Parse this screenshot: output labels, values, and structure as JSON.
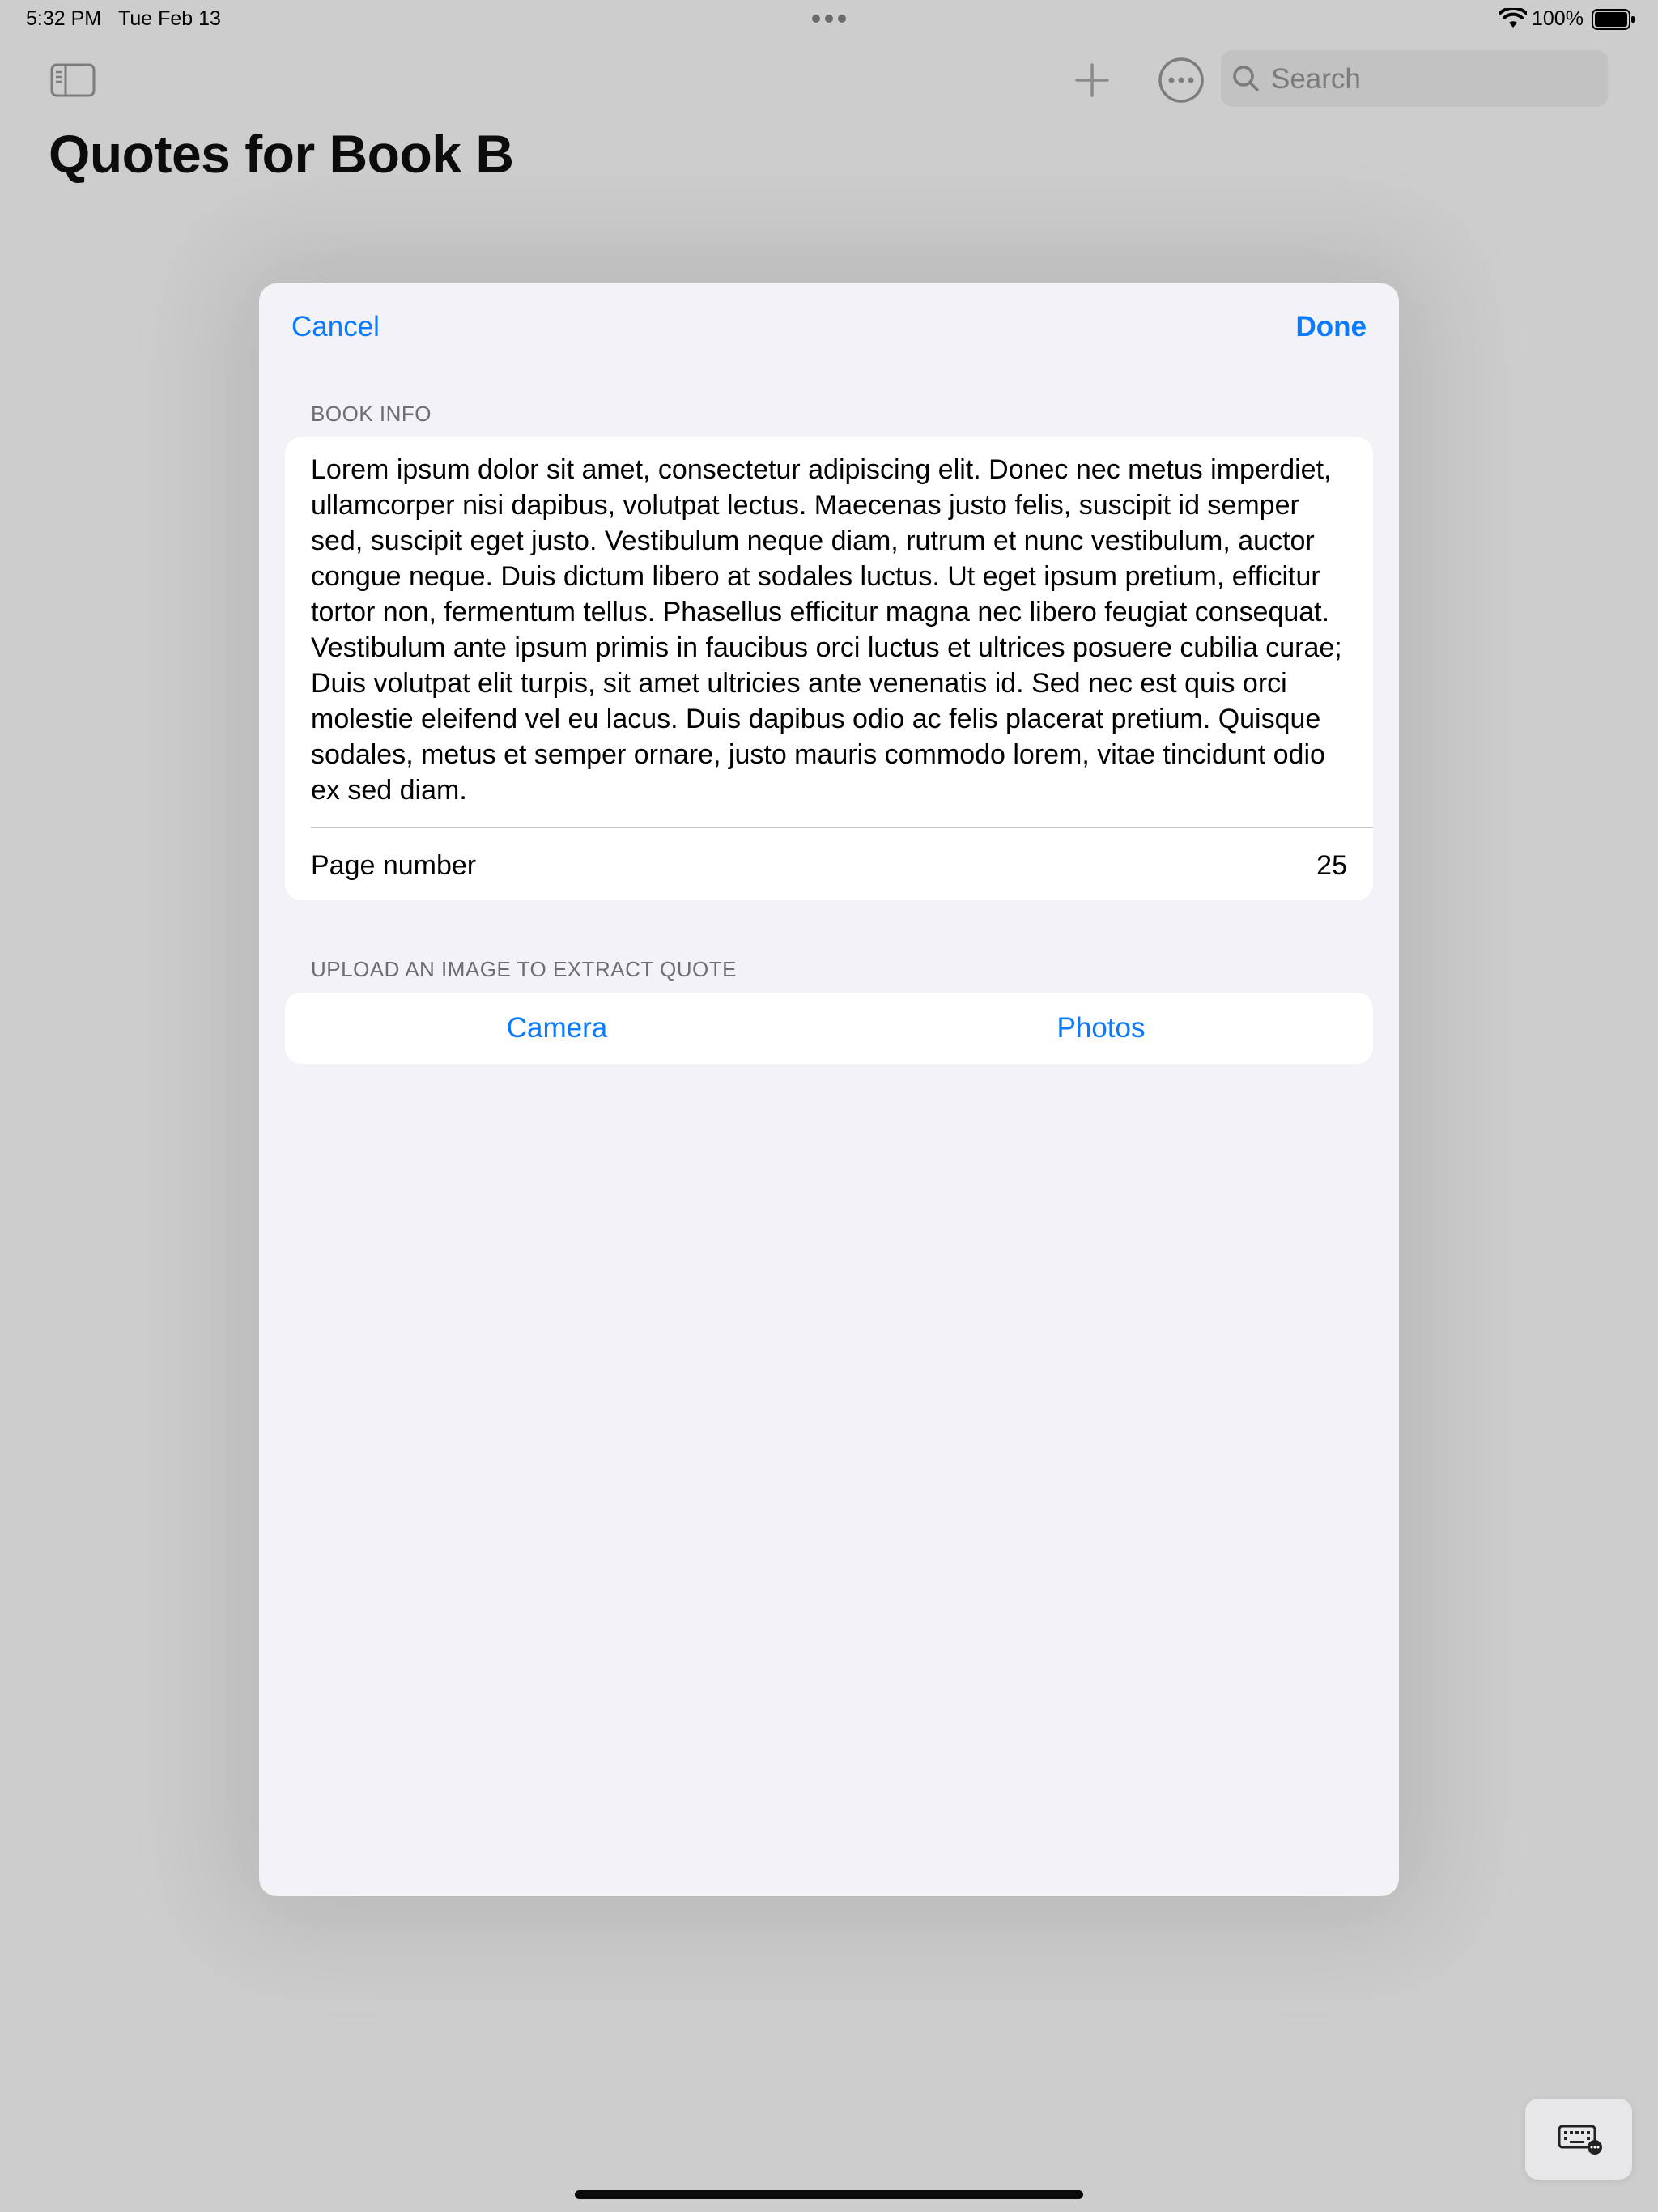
{
  "status_bar": {
    "time": "5:32 PM",
    "date": "Tue Feb 13",
    "battery": "100%"
  },
  "nav": {
    "title": "Quotes for Book B",
    "search_placeholder": "Search",
    "icons": [
      "sidebar-icon",
      "plus-icon",
      "ellipsis-circle-icon",
      "search-icon"
    ]
  },
  "sheet": {
    "cancel_label": "Cancel",
    "done_label": "Done",
    "book_info_header": "BOOK INFO",
    "quote_text": "Lorem ipsum dolor sit amet, consectetur adipiscing elit. Donec nec metus imperdiet, ullamcorper nisi dapibus, volutpat lectus. Maecenas justo felis, suscipit id semper sed, suscipit eget justo. Vestibulum neque diam, rutrum et nunc vestibulum, auctor congue neque. Duis dictum libero at sodales luctus. Ut eget ipsum pretium, efficitur tortor non, fermentum tellus. Phasellus efficitur magna nec libero feugiat consequat. Vestibulum ante ipsum primis in faucibus orci luctus et ultrices posuere cubilia curae; Duis volutpat elit turpis, sit amet ultricies ante venenatis id. Sed nec est quis orci molestie eleifend vel eu lacus. Duis dapibus odio ac felis placerat pretium. Quisque sodales, metus et semper ornare, justo mauris commodo lorem, vitae tincidunt odio ex sed diam.",
    "page_number_label": "Page number",
    "page_number_value": "25",
    "upload_header": "UPLOAD AN IMAGE TO EXTRACT QUOTE",
    "camera_label": "Camera",
    "photos_label": "Photos"
  },
  "colors": {
    "accent": "#0a7aff",
    "dimmed_background": "#cdcdcd",
    "sheet_background": "#f2f2f7"
  }
}
